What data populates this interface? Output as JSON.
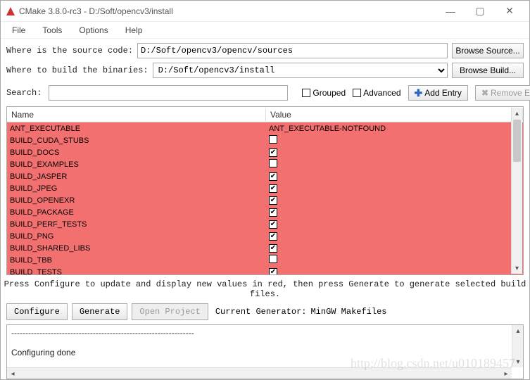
{
  "window": {
    "title": "CMake 3.8.0-rc3 - D:/Soft/opencv3/install"
  },
  "menu": {
    "file": "File",
    "tools": "Tools",
    "options": "Options",
    "help": "Help"
  },
  "labels": {
    "source": "Where is the source code:",
    "build": "Where to build the binaries:",
    "search": "Search:",
    "grouped": "Grouped",
    "advanced": "Advanced",
    "add_entry": "Add Entry",
    "remove_entry": "Remove Entry",
    "browse_source": "Browse Source...",
    "browse_build": "Browse Build..."
  },
  "paths": {
    "source": "D:/Soft/opencv3/opencv/sources",
    "build": "D:/Soft/opencv3/install"
  },
  "table": {
    "headers": {
      "name": "Name",
      "value": "Value"
    },
    "rows": [
      {
        "name": "ANT_EXECUTABLE",
        "value": "ANT_EXECUTABLE-NOTFOUND",
        "type": "text"
      },
      {
        "name": "BUILD_CUDA_STUBS",
        "value": false,
        "type": "check"
      },
      {
        "name": "BUILD_DOCS",
        "value": true,
        "type": "check"
      },
      {
        "name": "BUILD_EXAMPLES",
        "value": false,
        "type": "check"
      },
      {
        "name": "BUILD_JASPER",
        "value": true,
        "type": "check"
      },
      {
        "name": "BUILD_JPEG",
        "value": true,
        "type": "check"
      },
      {
        "name": "BUILD_OPENEXR",
        "value": true,
        "type": "check"
      },
      {
        "name": "BUILD_PACKAGE",
        "value": true,
        "type": "check"
      },
      {
        "name": "BUILD_PERF_TESTS",
        "value": true,
        "type": "check"
      },
      {
        "name": "BUILD_PNG",
        "value": true,
        "type": "check"
      },
      {
        "name": "BUILD_SHARED_LIBS",
        "value": true,
        "type": "check"
      },
      {
        "name": "BUILD_TBB",
        "value": false,
        "type": "check"
      },
      {
        "name": "BUILD_TESTS",
        "value": true,
        "type": "check"
      }
    ]
  },
  "hint": "Press Configure to update and display new values in red, then press Generate to generate selected build files.",
  "buttons": {
    "configure": "Configure",
    "generate": "Generate",
    "open_project": "Open Project"
  },
  "generator": {
    "label": "Current Generator:",
    "value": "MinGW Makefiles"
  },
  "log": {
    "dashes": "-----------------------------------------------------------------",
    "msg": "Configuring done"
  },
  "watermark": "http://blog.csdn.net/u010189457"
}
